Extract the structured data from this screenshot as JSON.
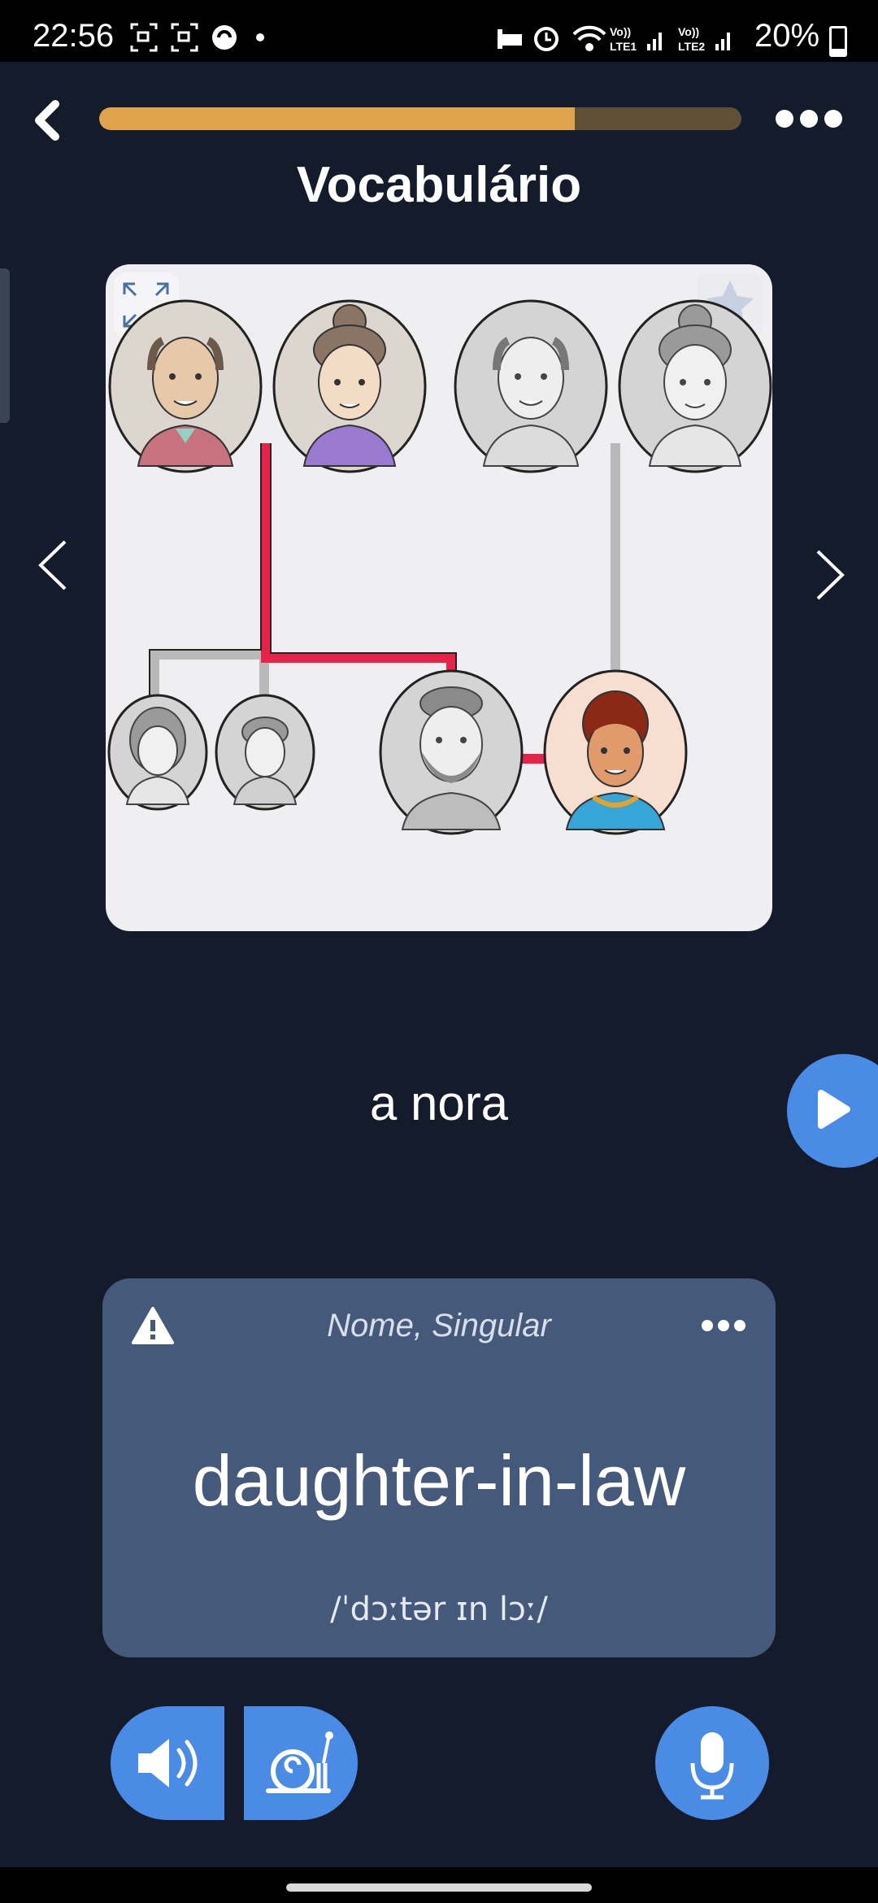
{
  "status_bar": {
    "time": "22:56",
    "battery": "20%",
    "net1": "Vo) LTE1",
    "net2": "Vo) LTE2"
  },
  "header": {
    "title": "Vocabulário",
    "progress_fraction": 0.74,
    "progress_color": "#e0a34b",
    "progress_track_color": "#5f4f35"
  },
  "card": {
    "expand_icon": "expand-icon",
    "favorite_icon": "star-icon"
  },
  "word": {
    "text": "a nora"
  },
  "translation_card": {
    "grammar": "Nome, Singular",
    "translation": "daughter-in-law",
    "phonetic": "/ˈdɔːtər ɪn lɔː/"
  },
  "colors": {
    "background": "#141c2b",
    "accent": "#4a8be6",
    "card": "#45597a",
    "highlight_line": "#e8234a"
  }
}
